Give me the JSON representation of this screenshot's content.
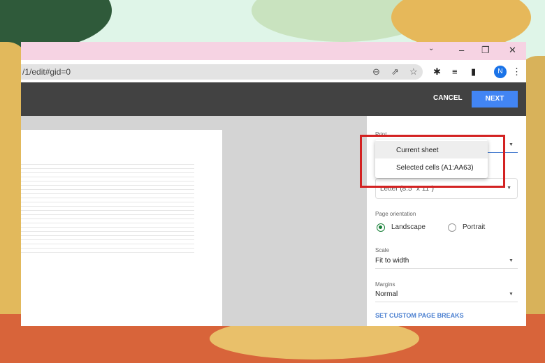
{
  "browser": {
    "url": "/1/edit#gid=0",
    "avatar_letter": "N",
    "icons": [
      "chevron-down-icon",
      "minimize-icon",
      "restore-icon",
      "close-icon",
      "zoom-icon",
      "share-icon",
      "star-icon",
      "extensions-icon",
      "media-icon",
      "sidebar-icon",
      "more-icon"
    ]
  },
  "toolbar": {
    "cancel_label": "CANCEL",
    "next_label": "NEXT"
  },
  "panel": {
    "print_label": "Print",
    "paper_size": "Letter (8.5\" x 11\")",
    "orientation_label": "Page orientation",
    "orientation_options": [
      "Landscape",
      "Portrait"
    ],
    "orientation_selected": "Landscape",
    "scale_label": "Scale",
    "scale_value": "Fit to width",
    "margins_label": "Margins",
    "margins_value": "Normal",
    "custom_breaks_link": "SET CUSTOM PAGE BREAKS"
  },
  "dropdown": {
    "options": [
      "Current sheet",
      "Selected cells (A1:AA63)"
    ],
    "highlighted": "Current sheet"
  },
  "colors": {
    "accent": "#4285f4",
    "highlight_box": "#d32222",
    "titlebar": "#f6d3e3",
    "radio_selected": "#188038"
  }
}
